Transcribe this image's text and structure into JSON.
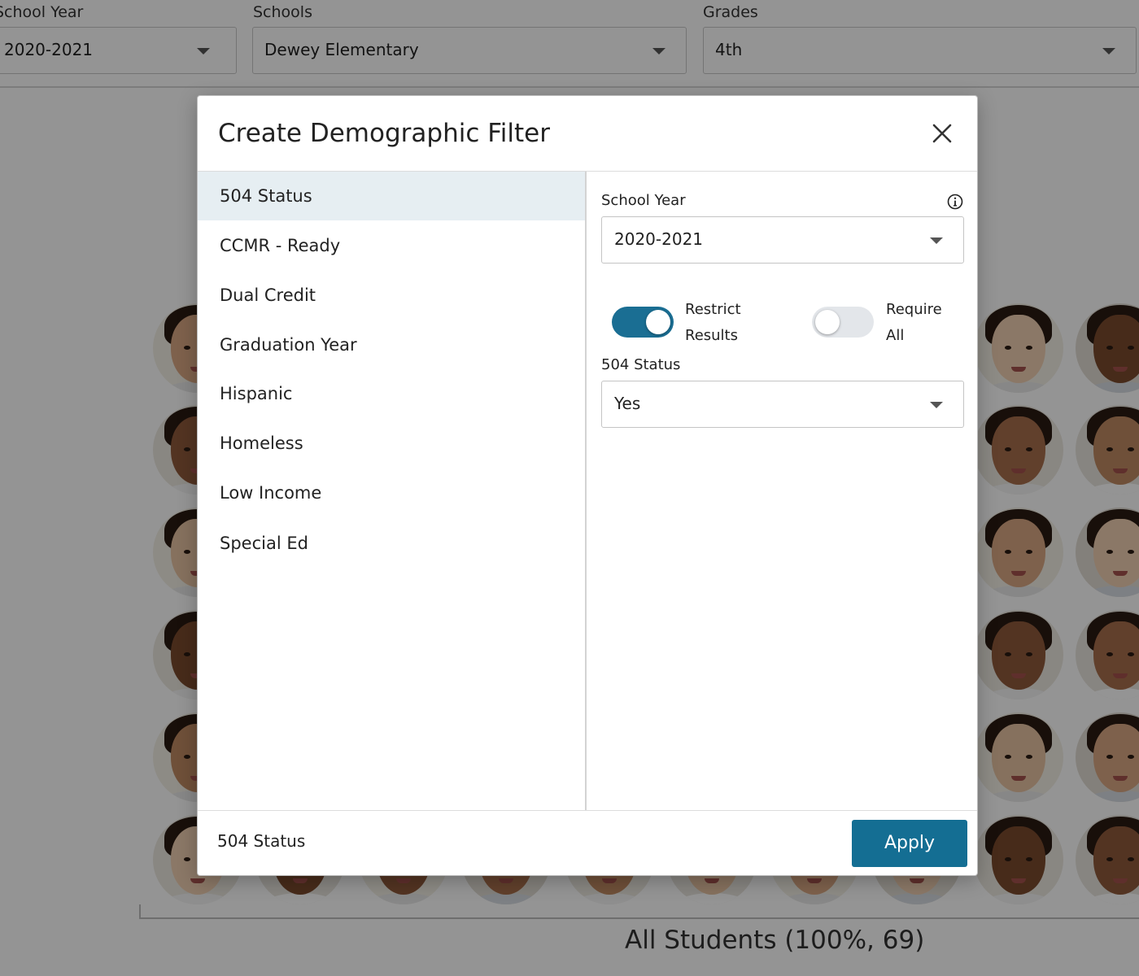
{
  "filters": [
    {
      "label": "School Year",
      "value": "2020-2021"
    },
    {
      "label": "Schools",
      "value": "Dewey Elementary"
    },
    {
      "label": "Grades",
      "value": "4th"
    }
  ],
  "chart_caption": "All Students (100%, 69)",
  "modal": {
    "title": "Create Demographic Filter",
    "categories": [
      "504 Status",
      "CCMR - Ready",
      "Dual Credit",
      "Graduation Year",
      "Hispanic",
      "Homeless",
      "Low Income",
      "Special Ed"
    ],
    "selected_category": "504 Status",
    "school_year_label": "School Year",
    "school_year_value": "2020-2021",
    "restrict_results": {
      "line1": "Restrict",
      "line2": "Results",
      "on": true
    },
    "require_all": {
      "line1": "Require",
      "line2": "All",
      "on": false
    },
    "status_label": "504 Status",
    "status_value": "Yes",
    "footer_summary": "504 Status",
    "apply_label": "Apply",
    "accent_color": "#146e93",
    "selected_row_color": "#e6eef2"
  }
}
